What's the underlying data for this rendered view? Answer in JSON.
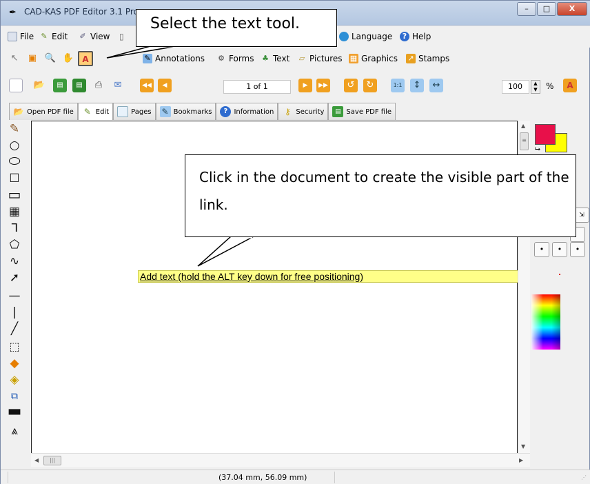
{
  "window": {
    "title": "CAD-KAS PDF Editor 3.1 Pro",
    "minimize": "–",
    "maximize": "□",
    "close": "X"
  },
  "menu": {
    "file": "File",
    "edit": "Edit",
    "view": "View",
    "language": "Language",
    "help": "Help"
  },
  "categories": {
    "annotations": "Annotations",
    "forms": "Forms",
    "text": "Text",
    "pictures": "Pictures",
    "graphics": "Graphics",
    "stamps": "Stamps"
  },
  "navigation": {
    "page_indicator": "1 of 1",
    "zoom_value": "100",
    "zoom_unit": "%"
  },
  "tabs": [
    {
      "label": "Open PDF file"
    },
    {
      "label": "Edit"
    },
    {
      "label": "Pages"
    },
    {
      "label": "Bookmarks"
    },
    {
      "label": "Information"
    },
    {
      "label": "Security"
    },
    {
      "label": "Save PDF file"
    }
  ],
  "document": {
    "add_text_placeholder": "Add text (hold the ALT key down for free positioning)"
  },
  "status": {
    "coordinates": "(37.04 mm, 56.09 mm)"
  },
  "callouts": {
    "select_tool": "Select the text tool.",
    "click_document": "Click in the document to create the visible part of the link."
  },
  "colors": {
    "foreground": "#e8104a",
    "background": "#ffff00",
    "highlight": "#ffff88"
  }
}
